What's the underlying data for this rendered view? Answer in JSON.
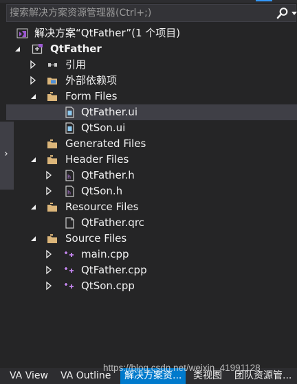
{
  "search": {
    "placeholder": "搜索解决方案资源管理器(Ctrl+;)"
  },
  "icons": {
    "search": "search-icon",
    "solution": "visual-studio-solution-icon",
    "project": "qt-project-icon",
    "references": "references-icon",
    "external_deps": "external-dependencies-icon",
    "filter_folder": "filter-folder-icon",
    "ui_file": "ui-file-icon",
    "header_file": "header-file-icon",
    "qrc_file": "resource-file-icon",
    "cpp_file": "cpp-file-icon"
  },
  "tree": {
    "solution": "解决方案“QtFather”(1 个项目)",
    "project": "QtFather",
    "references": "引用",
    "external_deps": "外部依赖项",
    "form_files": "Form Files",
    "form_items": [
      "QtFather.ui",
      "QtSon.ui"
    ],
    "generated_files": "Generated Files",
    "header_files": "Header Files",
    "header_items": [
      "QtFather.h",
      "QtSon.h"
    ],
    "resource_files": "Resource Files",
    "resource_items": [
      "QtFather.qrc"
    ],
    "source_files": "Source Files",
    "source_items": [
      "main.cpp",
      "QtFather.cpp",
      "QtSon.cpp"
    ]
  },
  "side_tab": {
    "glyph": "›"
  },
  "bottom_tabs": [
    "VA View",
    "VA Outline",
    "解决方案资...",
    "类视图",
    "团队资源管..."
  ],
  "watermark": "https://blog.csdn.net/weixin_41991128",
  "colors": {
    "background": "#252526",
    "selection": "#3f3f46",
    "active_tab": "#007acc",
    "folder": "#dcb67a",
    "cpp": "#c586f0",
    "vs_purple": "#9b59d0"
  }
}
